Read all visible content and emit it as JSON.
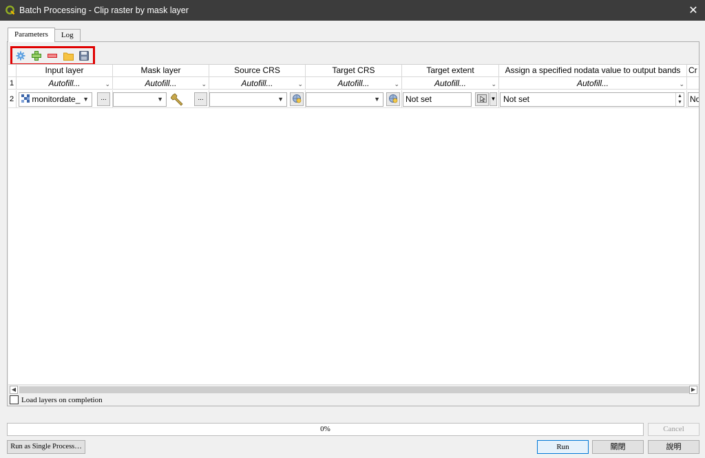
{
  "window": {
    "title": "Batch Processing - Clip raster by mask layer",
    "close_glyph": "✕"
  },
  "tabs": [
    {
      "label": "Parameters",
      "active": true
    },
    {
      "label": "Log",
      "active": false
    }
  ],
  "toolbar": {
    "icons": [
      "autofill-gear-icon",
      "add-row-icon",
      "remove-row-icon",
      "open-folder-icon",
      "save-icon"
    ],
    "highlight_color": "#e00000"
  },
  "table": {
    "columns": [
      "Input layer",
      "Mask layer",
      "Source CRS",
      "Target CRS",
      "Target extent",
      "Assign a specified nodata value to output bands",
      "Cr"
    ],
    "rows": [
      {
        "num": "1",
        "autofill": "Autofill..."
      },
      {
        "num": "2",
        "input_layer": "monitordate_",
        "mask_layer": "",
        "source_crs": "",
        "target_crs": "",
        "target_extent": "Not set",
        "nodata": "Not set",
        "next": "No"
      }
    ],
    "browse_label": "...",
    "combo_arrow": "▼"
  },
  "load_on_completion": {
    "label": "Load layers on completion",
    "checked": false
  },
  "progress": {
    "value": 0,
    "text": "0%"
  },
  "buttons": {
    "cancel": "Cancel",
    "single_process": "Run as Single Process…",
    "run": "Run",
    "close": "關閉",
    "help": "說明"
  }
}
